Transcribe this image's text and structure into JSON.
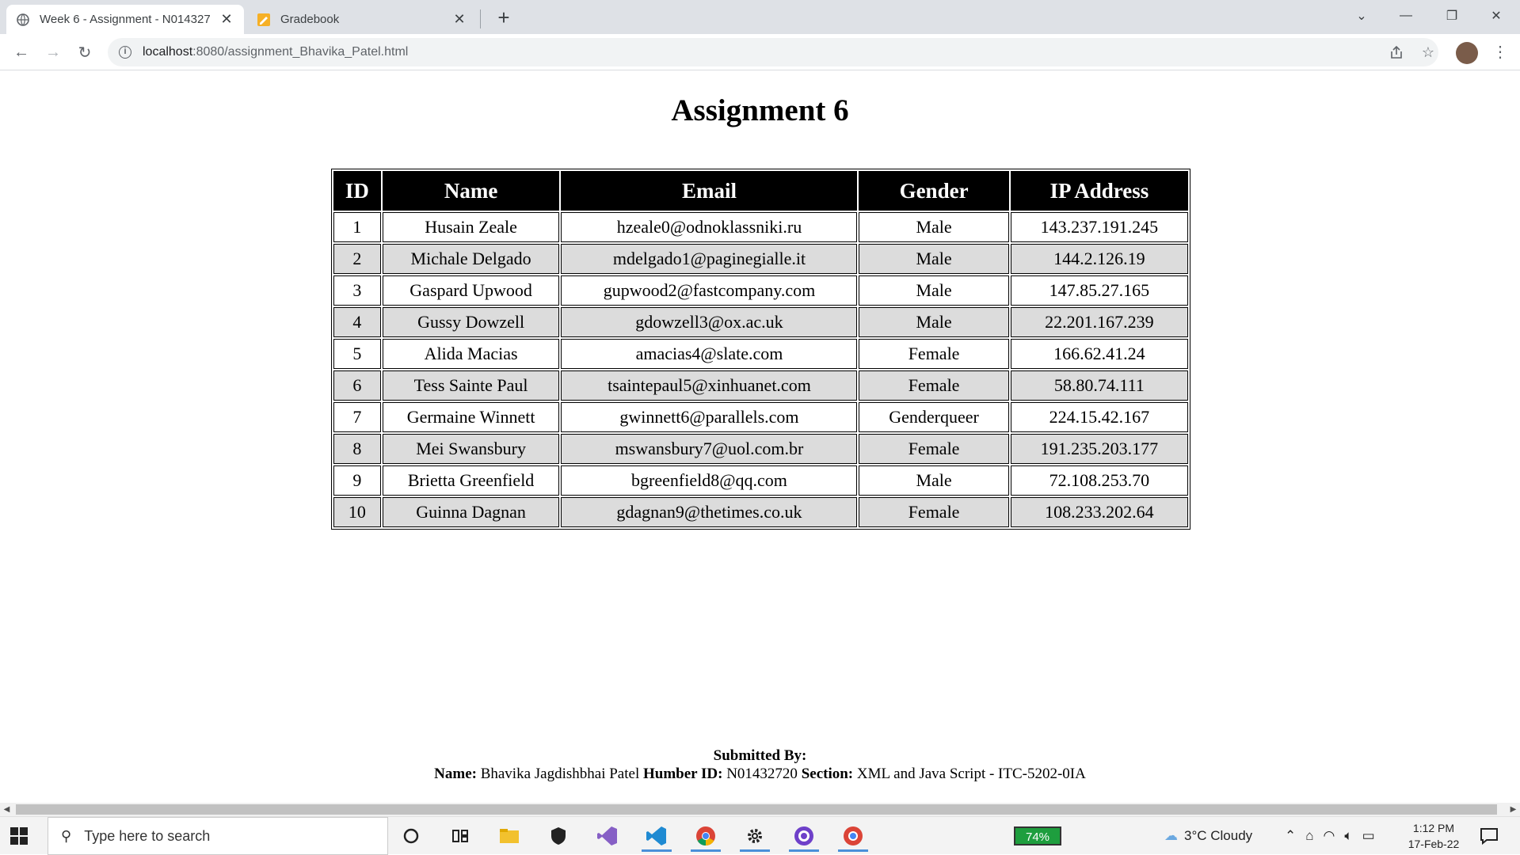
{
  "browser": {
    "tabs": [
      {
        "title": "Week 6 - Assignment - N014327",
        "active": true,
        "icon": "globe-icon"
      },
      {
        "title": "Gradebook",
        "active": false,
        "icon": "gradebook-icon"
      }
    ],
    "new_tab": "+",
    "url_host": "localhost",
    "url_path": ":8080/assignment_Bhavika_Patel.html"
  },
  "page": {
    "heading": "Assignment 6",
    "table": {
      "headers": [
        "ID",
        "Name",
        "Email",
        "Gender",
        "IP Address"
      ],
      "rows": [
        [
          "1",
          "Husain Zeale",
          "hzeale0@odnoklassniki.ru",
          "Male",
          "143.237.191.245"
        ],
        [
          "2",
          "Michale Delgado",
          "mdelgado1@paginegialle.it",
          "Male",
          "144.2.126.19"
        ],
        [
          "3",
          "Gaspard Upwood",
          "gupwood2@fastcompany.com",
          "Male",
          "147.85.27.165"
        ],
        [
          "4",
          "Gussy Dowzell",
          "gdowzell3@ox.ac.uk",
          "Male",
          "22.201.167.239"
        ],
        [
          "5",
          "Alida Macias",
          "amacias4@slate.com",
          "Female",
          "166.62.41.24"
        ],
        [
          "6",
          "Tess Sainte Paul",
          "tsaintepaul5@xinhuanet.com",
          "Female",
          "58.80.74.111"
        ],
        [
          "7",
          "Germaine Winnett",
          "gwinnett6@parallels.com",
          "Genderqueer",
          "224.15.42.167"
        ],
        [
          "8",
          "Mei Swansbury",
          "mswansbury7@uol.com.br",
          "Female",
          "191.235.203.177"
        ],
        [
          "9",
          "Brietta Greenfield",
          "bgreenfield8@qq.com",
          "Male",
          "72.108.253.70"
        ],
        [
          "10",
          "Guinna Dagnan",
          "gdagnan9@thetimes.co.uk",
          "Female",
          "108.233.202.64"
        ]
      ]
    },
    "footer": {
      "submitted_by": "Submitted By:",
      "name_label": "Name:",
      "name_value": "Bhavika Jagdishbhai Patel",
      "id_label": "Humber ID:",
      "id_value": "N01432720",
      "section_label": "Section:",
      "section_value": "XML and Java Script - ITC-5202-0IA"
    }
  },
  "taskbar": {
    "search_placeholder": "Type here to search",
    "battery": "74%",
    "weather": "3°C  Cloudy",
    "time": "1:12 PM",
    "date": "17-Feb-22"
  },
  "colors": {
    "header_bg": "#000000",
    "header_fg": "#ffffff",
    "row_alt_bg": "#dcdcdc"
  }
}
